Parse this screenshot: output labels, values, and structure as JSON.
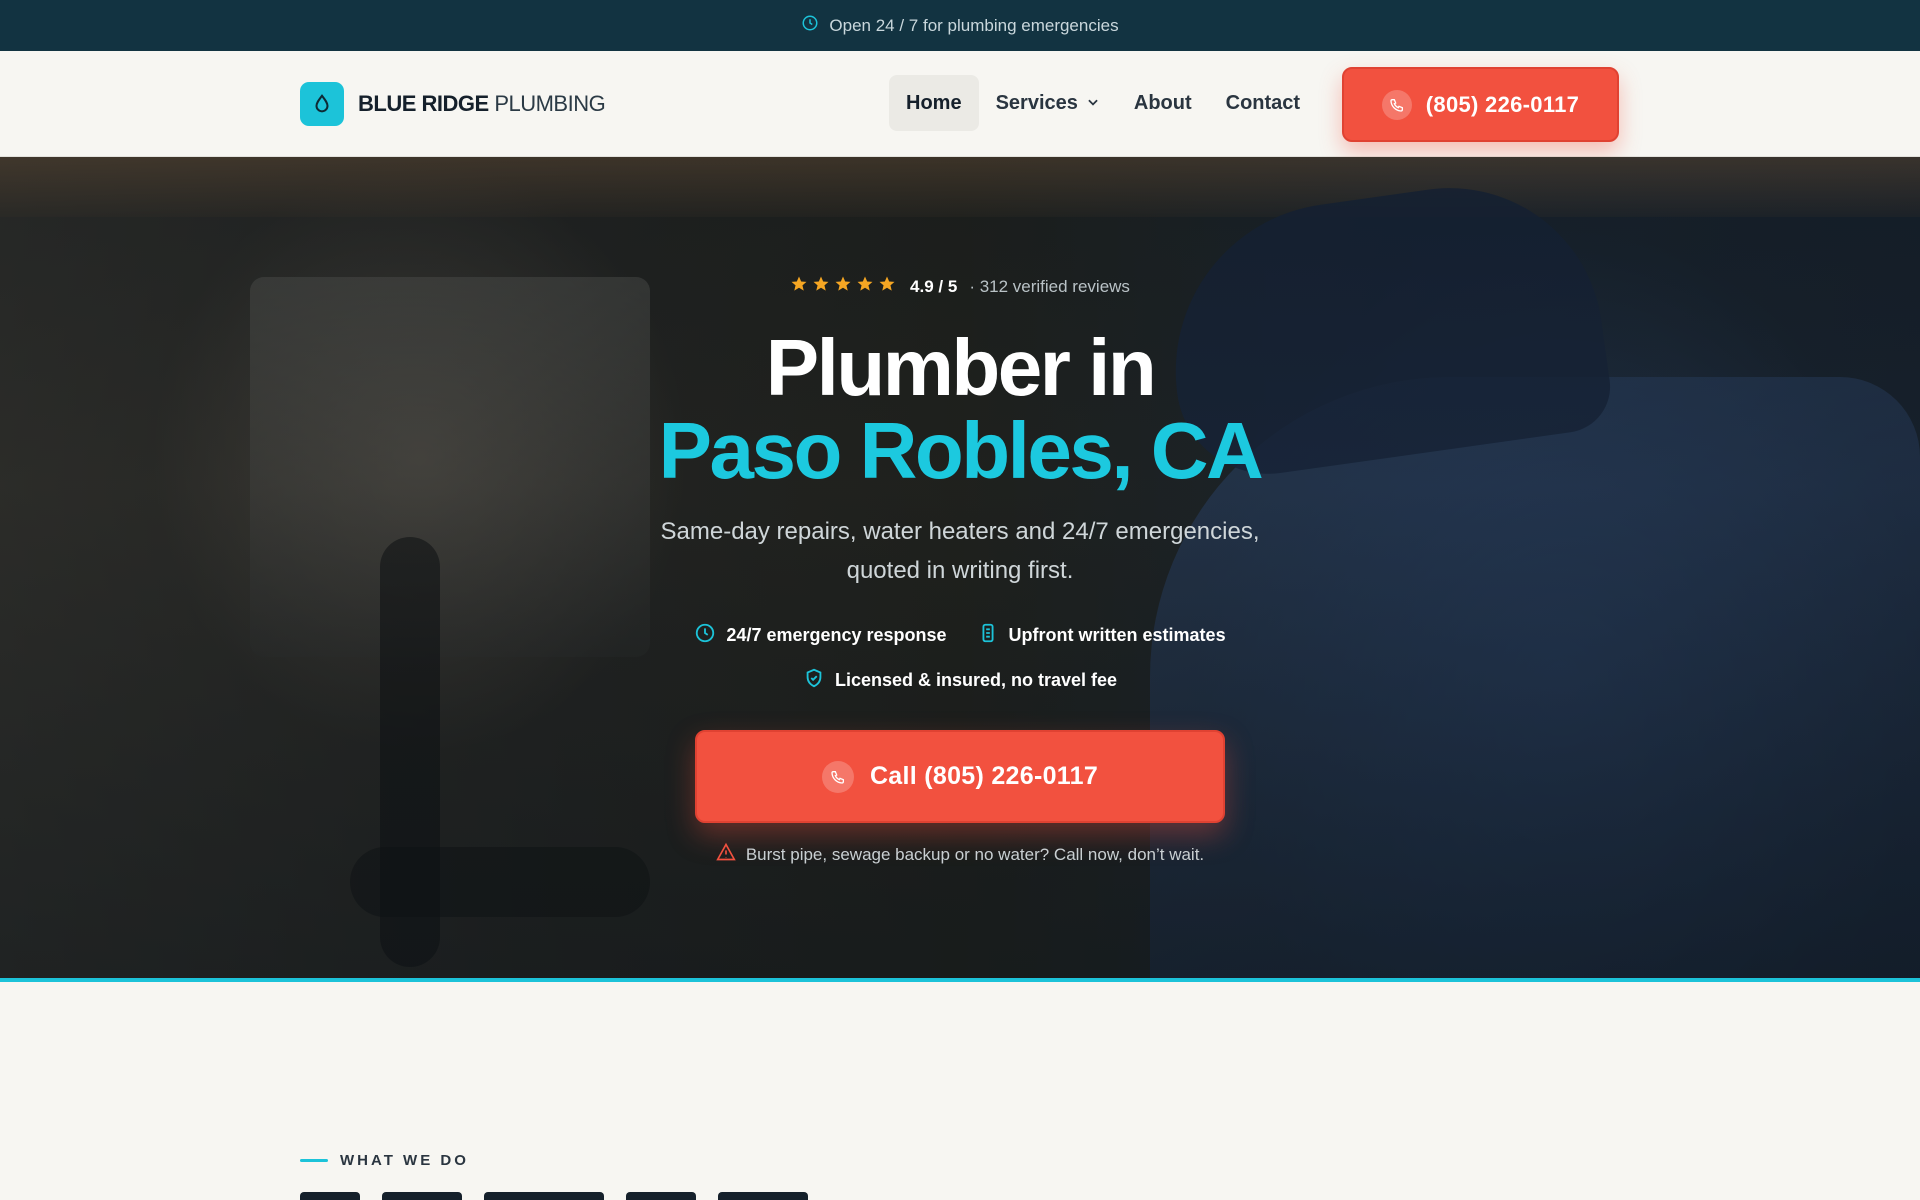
{
  "topbar": {
    "icon": "clock-icon",
    "text": "Open 24 / 7 for plumbing emergencies"
  },
  "brand": {
    "icon": "water-drop-icon",
    "name_bold": "BLUE RIDGE",
    "name_light": "PLUMBING"
  },
  "nav": {
    "home": "Home",
    "services": "Services",
    "about": "About",
    "contact": "Contact",
    "phone": "(805) 226-0117"
  },
  "hero": {
    "rating": {
      "stars": 5,
      "score": "4.9 / 5",
      "count": "· 312 verified reviews"
    },
    "title_line1": "Plumber in",
    "title_line2": "Paso Robles, CA",
    "subtitle_line1": "Same-day repairs, water heaters and 24/7 emergencies,",
    "subtitle_line2": "quoted in writing first.",
    "features": [
      {
        "icon": "clock-icon",
        "label": "24/7 emergency response"
      },
      {
        "icon": "document-icon",
        "label": "Upfront written estimates"
      },
      {
        "icon": "shield-check-icon",
        "label": "Licensed & insured, no travel fee"
      }
    ],
    "cta": "Call (805) 226-0117",
    "alert": "Burst pipe, sewage backup or no water? Call now, don’t wait."
  },
  "section": {
    "eyebrow": "WHAT WE DO"
  },
  "colors": {
    "accent": "#1cc9df",
    "cta": "#f2513f",
    "dark": "#123341",
    "star": "#f5a623"
  }
}
